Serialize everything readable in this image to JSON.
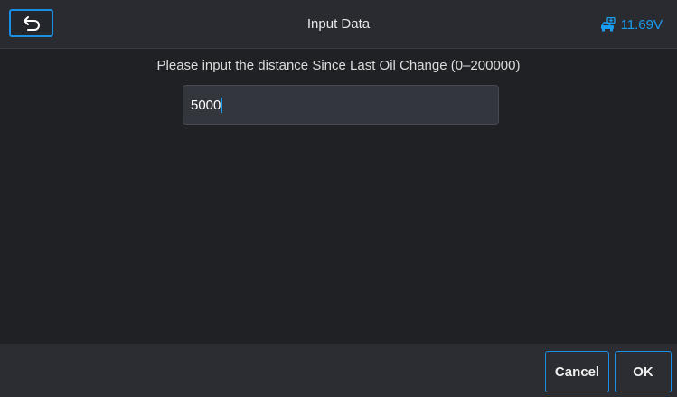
{
  "header": {
    "title": "Input Data",
    "voltage": "11.69V",
    "back_icon": "back-arrow-icon",
    "vehicle_battery_icon": "car-battery-icon"
  },
  "main": {
    "prompt": "Please input the distance Since Last Oil Change (0–200000)",
    "input_value": "5000"
  },
  "footer": {
    "cancel_label": "Cancel",
    "ok_label": "OK"
  },
  "colors": {
    "accent": "#1a9cf0",
    "background": "#1f2125",
    "header_bg": "#292b30",
    "input_bg": "#33363c"
  }
}
